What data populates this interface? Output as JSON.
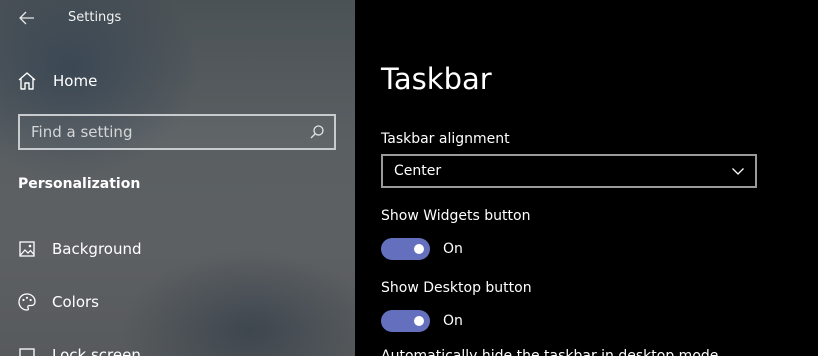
{
  "window": {
    "title": "Settings"
  },
  "sidebar": {
    "home_label": "Home",
    "search": {
      "placeholder": "Find a setting",
      "value": ""
    },
    "section_title": "Personalization",
    "items": [
      {
        "label": "Background",
        "icon": "image-icon"
      },
      {
        "label": "Colors",
        "icon": "palette-icon"
      },
      {
        "label": "Lock screen",
        "icon": "lock-screen-icon"
      }
    ]
  },
  "main": {
    "page_title": "Taskbar",
    "alignment": {
      "label": "Taskbar alignment",
      "selected": "Center"
    },
    "widgets": {
      "label": "Show Widgets button",
      "state": "On",
      "on": true
    },
    "desktop": {
      "label": "Show Desktop button",
      "state": "On",
      "on": true
    },
    "cut_text": "Automatically hide the taskbar in desktop mode"
  },
  "colors": {
    "accent": "#6470be",
    "sidebar_bg": "#5a5f62",
    "main_bg": "#000000"
  }
}
